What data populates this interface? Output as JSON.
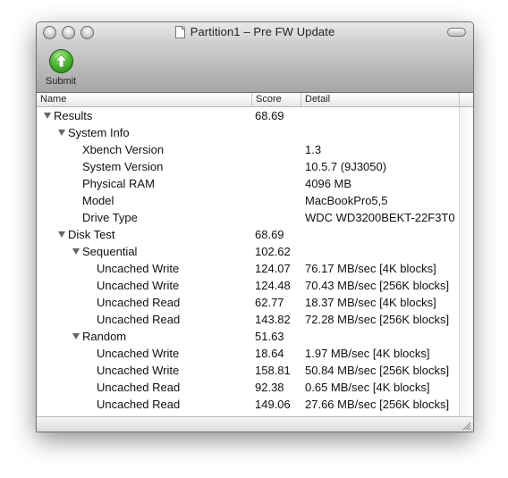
{
  "window": {
    "title": "Partition1 – Pre FW Update"
  },
  "toolbar": {
    "submit_label": "Submit",
    "submit_icon": "up-arrow-icon"
  },
  "columns": {
    "name": "Name",
    "score": "Score",
    "detail": "Detail"
  },
  "rows": [
    {
      "name": "Results",
      "score": "68.69",
      "detail": "",
      "level": 0,
      "disclosure": "expanded"
    },
    {
      "name": "System Info",
      "score": "",
      "detail": "",
      "level": 1,
      "disclosure": "expanded"
    },
    {
      "name": "Xbench Version",
      "score": "",
      "detail": "1.3",
      "level": 2,
      "disclosure": "none"
    },
    {
      "name": "System Version",
      "score": "",
      "detail": "10.5.7 (9J3050)",
      "level": 2,
      "disclosure": "none"
    },
    {
      "name": "Physical RAM",
      "score": "",
      "detail": "4096 MB",
      "level": 2,
      "disclosure": "none"
    },
    {
      "name": "Model",
      "score": "",
      "detail": "MacBookPro5,5",
      "level": 2,
      "disclosure": "none"
    },
    {
      "name": "Drive Type",
      "score": "",
      "detail": "WDC WD3200BEKT-22F3T0",
      "level": 2,
      "disclosure": "none"
    },
    {
      "name": "Disk Test",
      "score": "68.69",
      "detail": "",
      "level": 1,
      "disclosure": "expanded"
    },
    {
      "name": "Sequential",
      "score": "102.62",
      "detail": "",
      "level": 2,
      "disclosure": "expanded"
    },
    {
      "name": "Uncached Write",
      "score": "124.07",
      "detail": "76.17 MB/sec [4K blocks]",
      "level": 3,
      "disclosure": "none"
    },
    {
      "name": "Uncached Write",
      "score": "124.48",
      "detail": "70.43 MB/sec [256K blocks]",
      "level": 3,
      "disclosure": "none"
    },
    {
      "name": "Uncached Read",
      "score": "62.77",
      "detail": "18.37 MB/sec [4K blocks]",
      "level": 3,
      "disclosure": "none"
    },
    {
      "name": "Uncached Read",
      "score": "143.82",
      "detail": "72.28 MB/sec [256K blocks]",
      "level": 3,
      "disclosure": "none"
    },
    {
      "name": "Random",
      "score": "51.63",
      "detail": "",
      "level": 2,
      "disclosure": "expanded"
    },
    {
      "name": "Uncached Write",
      "score": "18.64",
      "detail": "1.97 MB/sec [4K blocks]",
      "level": 3,
      "disclosure": "none"
    },
    {
      "name": "Uncached Write",
      "score": "158.81",
      "detail": "50.84 MB/sec [256K blocks]",
      "level": 3,
      "disclosure": "none"
    },
    {
      "name": "Uncached Read",
      "score": "92.38",
      "detail": "0.65 MB/sec [4K blocks]",
      "level": 3,
      "disclosure": "none"
    },
    {
      "name": "Uncached Read",
      "score": "149.06",
      "detail": "27.66 MB/sec [256K blocks]",
      "level": 3,
      "disclosure": "none"
    }
  ]
}
